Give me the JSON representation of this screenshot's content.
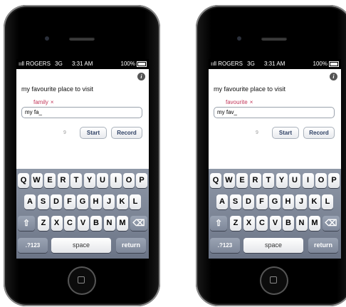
{
  "phones": [
    {
      "status": {
        "carrier": "ROGERS",
        "network": "3G",
        "time": "3:31 AM",
        "battery": "100%"
      },
      "info_glyph": "i",
      "prompt": "my favourite place to visit",
      "suggestion": {
        "word": "family",
        "remove": "×"
      },
      "input_value": "my fa_",
      "count": "9",
      "start_label": "Start",
      "record_label": "Record"
    },
    {
      "status": {
        "carrier": "ROGERS",
        "network": "3G",
        "time": "3:31 AM",
        "battery": "100%"
      },
      "info_glyph": "i",
      "prompt": "my favourite place to visit",
      "suggestion": {
        "word": "favourite",
        "remove": "×"
      },
      "input_value": "my fav_",
      "count": "9",
      "start_label": "Start",
      "record_label": "Record"
    }
  ],
  "keyboard": {
    "row1": [
      "Q",
      "W",
      "E",
      "R",
      "T",
      "Y",
      "U",
      "I",
      "O",
      "P"
    ],
    "row2": [
      "A",
      "S",
      "D",
      "F",
      "G",
      "H",
      "J",
      "K",
      "L"
    ],
    "row3": [
      "Z",
      "X",
      "C",
      "V",
      "B",
      "N",
      "M"
    ],
    "shift_glyph": "⇧",
    "delete_glyph": "⌫",
    "numbers_label": ".?123",
    "space_label": "space",
    "return_label": "return"
  },
  "icons": {
    "signal": "signal-bars-icon",
    "battery": "battery-icon",
    "info": "info-icon",
    "home": "home-button"
  }
}
